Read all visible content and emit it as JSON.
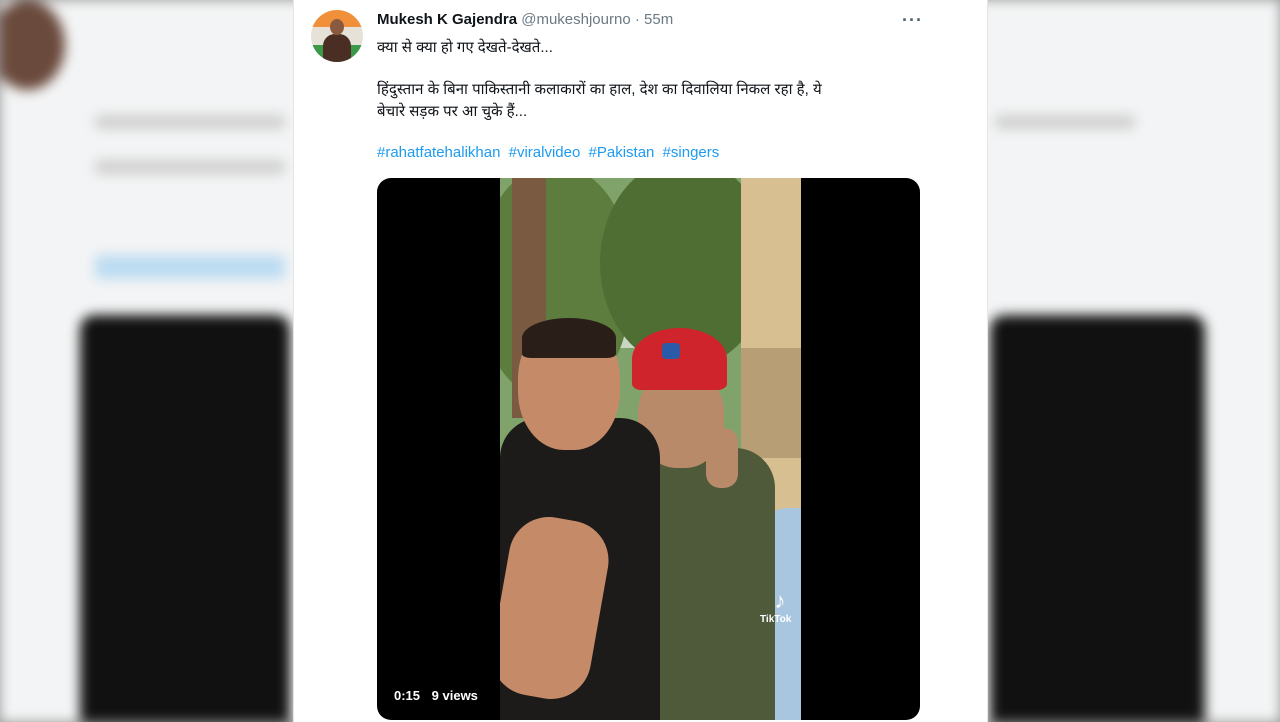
{
  "tweet": {
    "display_name": "Mukesh K Gajendra",
    "handle": "@mukeshjourno",
    "separator": "·",
    "time": "55m",
    "more_label": "···",
    "text_line1": "क्या से क्या हो गए देखते-देखते...",
    "text_line2": "हिंदुस्तान के बिना पाकिस्तानी कलाकारों का हाल, देश का दिवालिया निकल रहा है, ये",
    "text_line3": "बेचारे सड़क पर आ चुके हैं...",
    "hashtags": [
      "#rahatfatehalikhan",
      "#viralvideo",
      "#Pakistan",
      "#singers"
    ]
  },
  "media": {
    "video_time": "0:15",
    "video_views": "9 views",
    "watermark_icon": "tiktok-icon",
    "watermark_label": "TikTok"
  },
  "colors": {
    "link": "#1d9bf0",
    "text": "#0f1419",
    "muted": "#6b7a85"
  }
}
